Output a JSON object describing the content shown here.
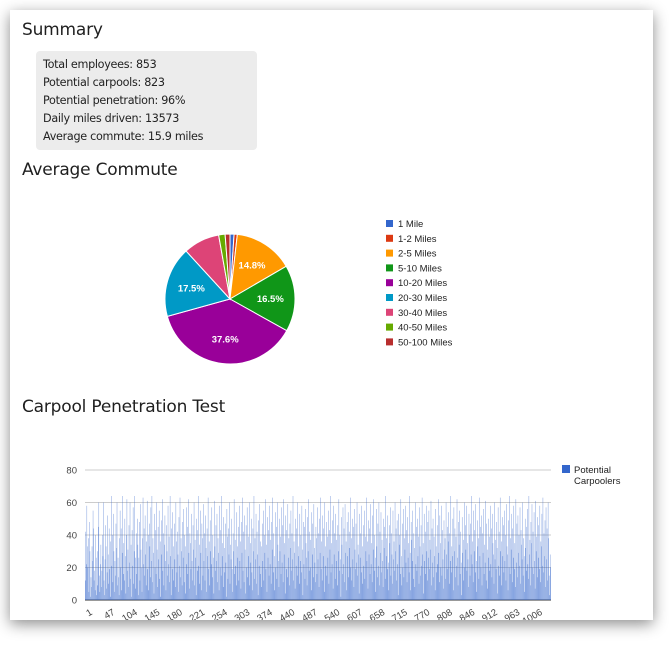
{
  "summary": {
    "title": "Summary",
    "lines": [
      "Total employees: 853",
      "Potential carpools: 823",
      "Potential penetration: 96%",
      "Daily miles driven: 13573",
      "Average commute: 15.9 miles"
    ]
  },
  "avg_commute": {
    "title": "Average Commute"
  },
  "penetration": {
    "title": "Carpool Penetration Test"
  },
  "colors": {
    "1 Mile": "#3366cc",
    "1-2 Miles": "#dc3912",
    "2-5 Miles": "#ff9900",
    "5-10 Miles": "#109618",
    "10-20 Miles": "#990099",
    "20-30 Miles": "#0099c6",
    "30-40 Miles": "#dd4477",
    "40-50 Miles": "#66aa00",
    "50-100 Miles": "#b82e2e"
  },
  "chart_data": [
    {
      "type": "pie",
      "title": "Average Commute",
      "labels": [
        "1 Mile",
        "1-2 Miles",
        "2-5 Miles",
        "5-10 Miles",
        "10-20 Miles",
        "20-30 Miles",
        "30-40 Miles",
        "40-50 Miles",
        "50-100 Miles"
      ],
      "values": [
        1.0,
        0.8,
        14.8,
        16.5,
        37.6,
        17.5,
        9.0,
        1.6,
        1.2
      ],
      "slice_labels": [
        "",
        "",
        "14.8%",
        "16.5%",
        "37.6%",
        "17.5%",
        "",
        "",
        ""
      ],
      "legend": "right"
    },
    {
      "type": "bar",
      "title": "Carpool Penetration Test",
      "series": [
        {
          "name": "Potential Carpoolers"
        }
      ],
      "x_tick_labels": [
        "1",
        "47",
        "104",
        "145",
        "180",
        "221",
        "254",
        "303",
        "374",
        "440",
        "487",
        "540",
        "607",
        "658",
        "715",
        "770",
        "808",
        "846",
        "912",
        "963",
        "1006"
      ],
      "ylim": [
        0,
        80
      ],
      "y_ticks": [
        0,
        20,
        40,
        60,
        80
      ],
      "grid": true,
      "legend": "top-right",
      "values": [
        12,
        42,
        22,
        58,
        33,
        20,
        38,
        5,
        48,
        30,
        2,
        14,
        8,
        33,
        24,
        55,
        44,
        12,
        18,
        6,
        40,
        26,
        3,
        30,
        9,
        45,
        60,
        15,
        5,
        22,
        34,
        8,
        18,
        40,
        27,
        60,
        12,
        3,
        25,
        46,
        33,
        7,
        17,
        52,
        28,
        10,
        44,
        19,
        2,
        36,
        64,
        21,
        40,
        11,
        53,
        30,
        5,
        24,
        15,
        47,
        32,
        60,
        9,
        26,
        14,
        3,
        38,
        55,
        20,
        44,
        6,
        29,
        64,
        16,
        35,
        12,
        50,
        27,
        4,
        40,
        62,
        18,
        31,
        8,
        46,
        23,
        60,
        13,
        34,
        2,
        43,
        21,
        57,
        10,
        30,
        64,
        26,
        7,
        41,
        16,
        50,
        34,
        3,
        26,
        48,
        12,
        59,
        31,
        20,
        5,
        38,
        63,
        22,
        44,
        15,
        52,
        28,
        9,
        36,
        61,
        19,
        40,
        6,
        47,
        33,
        14,
        57,
        24,
        64,
        11,
        38,
        29,
        4,
        53,
        20,
        43,
        16,
        60,
        31,
        8,
        45,
        25,
        55,
        13,
        36,
        2,
        49,
        28,
        62,
        18,
        41,
        9,
        34,
        52,
        24,
        6,
        46,
        30,
        15,
        58,
        22,
        39,
        11,
        64,
        27,
        3,
        44,
        19,
        54,
        33,
        12,
        47,
        25,
        8,
        60,
        36,
        17,
        42,
        28,
        5,
        51,
        21,
        63,
        14,
        38,
        30,
        9,
        48,
        26,
        56,
        11,
        40,
        33,
        4,
        57,
        22,
        45,
        16,
        62,
        29,
        7,
        41,
        35,
        19,
        53,
        24,
        12,
        46,
        31,
        60,
        9,
        37,
        26,
        3,
        50,
        43,
        18,
        64,
        21,
        34,
        10,
        55,
        29,
        6,
        47,
        38,
        15,
        59,
        24,
        41,
        12,
        52,
        32,
        5,
        44,
        27,
        63,
        19,
        36,
        9,
        49,
        30,
        22,
        57,
        14,
        40,
        26,
        4,
        61,
        33,
        18,
        46,
        24,
        53,
        11,
        38,
        29,
        6,
        58,
        20,
        43,
        15,
        64,
        27,
        35,
        8,
        51,
        32,
        17,
        47,
        23,
        2,
        56,
        39,
        13,
        44,
        28,
        60,
        10,
        34,
        25,
        50,
        19,
        5,
        41,
        30,
        62,
        16,
        37,
        21,
        9,
        54,
        33,
        26,
        45,
        12,
        58,
        24,
        36,
        7,
        48,
        29,
        63,
        18,
        42,
        11,
        52,
        31,
        4,
        46,
        20,
        57,
        14,
        39,
        27,
        60,
        9,
        35,
        23,
        50,
        17,
        6,
        44,
        30,
        64,
        13,
        38,
        25,
        53,
        10,
        42,
        28,
        3,
        49,
        21,
        59,
        16,
        36,
        33,
        8,
        47,
        24,
        55,
        12,
        40,
        29,
        62,
        19,
        34,
        5,
        51,
        26,
        43,
        15,
        58,
        22,
        37,
        10,
        48,
        31,
        63,
        17,
        41,
        27,
        6,
        54,
        20,
        45,
        13,
        60,
        34,
        24,
        8,
        50,
        30,
        39,
        16,
        57,
        23,
        46,
        11,
        62,
        28,
        35,
        4,
        52,
        19,
        43,
        14,
        59,
        26,
        38,
        9,
        47,
        32,
        55,
        18,
        41,
        25,
        64,
        12,
        36,
        29,
        7,
        50,
        21,
        44,
        15,
        60,
        33,
        27,
        10,
        53,
        24,
        40,
        17,
        58,
        31,
        3,
        48,
        22,
        45,
        13,
        56,
        35,
        26,
        9,
        51,
        30,
        62,
        18,
        42,
        20,
        37,
        6,
        54,
        28,
        47,
        14,
        59,
        32,
        23,
        11,
        45,
        38,
        16,
        57,
        25,
        41,
        8,
        50,
        29,
        63,
        19,
        36,
        12,
        52,
        27,
        44,
        5,
        60,
        33,
        21,
        48,
        15,
        39,
        26,
        55,
        10,
        43,
        31,
        64,
        17,
        35,
        22,
        49,
        7,
        58,
        28,
        41,
        13,
        53,
        24,
        37,
        9,
        46,
        30,
        62,
        18,
        40,
        25,
        2,
        51,
        34,
        16,
        57,
        22,
        44,
        11,
        59,
        29,
        36,
        6,
        48,
        27,
        54,
        14,
        42,
        32,
        63,
        20,
        38,
        12,
        50,
        25,
        45,
        8,
        56,
        31,
        19,
        47,
        23,
        60,
        15,
        34,
        28,
        4,
        53,
        26,
        41,
        17,
        58,
        33,
        10,
        46,
        21,
        55,
        13,
        39,
        30,
        63,
        24,
        36,
        7,
        49,
        28,
        44,
        16,
        59,
        22,
        35,
        11,
        52,
        31,
        62,
        18,
        40,
        26,
        5,
        56,
        33,
        14,
        47,
        21,
        60,
        9,
        42,
        29,
        54,
        17,
        37,
        24,
        8,
        50,
        32,
        45,
        13,
        64,
        27,
        38,
        19,
        52,
        23,
        6,
        46,
        35,
        57,
        15,
        41,
        28,
        10,
        55,
        25,
        36,
        18,
        60,
        30,
        44,
        12,
        49,
        22,
        3,
        53,
        34,
        40,
        16,
        62,
        27,
        9,
        47,
        20,
        56,
        14,
        38,
        31,
        58,
        23,
        43,
        11,
        51,
        26,
        35,
        17,
        64,
        29,
        6,
        48,
        37,
        24,
        55,
        13,
        41,
        32,
        8,
        60,
        22,
        45,
        18,
        50,
        27,
        39,
        10,
        57,
        33,
        15,
        46,
        21,
        63,
        28,
        35,
        4,
        53,
        24,
        42,
        16,
        58,
        30,
        12,
        48,
        26,
        55,
        19,
        37,
        31,
        61,
        9,
        44,
        23,
        50,
        14,
        39,
        27,
        6,
        56,
        33,
        17,
        46,
        22,
        62,
        29,
        11,
        52,
        35,
        20,
        58,
        15,
        43,
        25,
        7,
        49,
        31,
        38,
        13,
        60,
        28,
        19,
        45,
        36,
        54,
        10,
        41,
        24,
        64,
        17,
        33,
        27,
        50,
        6,
        57,
        30,
        44,
        14,
        39,
        21,
        62,
        26,
        9,
        48,
        34,
        55,
        16,
        42,
        23,
        3,
        51,
        29,
        37,
        12,
        60,
        20,
        46,
        31,
        58,
        18,
        35,
        25,
        8,
        53,
        40,
        15,
        47,
        28,
        64,
        22,
        36,
        11,
        55,
        30,
        43,
        17,
        59,
        24,
        5,
        49,
        33,
        38,
        13,
        63,
        27,
        45,
        20,
        52,
        9,
        41,
        29,
        56,
        16,
        34,
        23,
        61,
        12,
        47,
        31,
        7,
        50,
        26,
        39,
        18,
        58,
        22,
        44,
        14,
        53,
        35,
        28,
        10,
        60,
        25,
        37,
        19,
        48,
        32,
        4,
        57,
        21,
        42,
        15,
        63,
        30,
        36,
        9,
        51,
        27,
        46,
        17,
        55,
        24,
        40,
        12,
        59,
        33,
        28,
        6,
        49,
        20,
        64,
        16,
        38,
        31,
        53,
        11,
        44,
        26,
        58,
        19,
        35,
        8,
        62,
        23,
        47,
        14,
        52,
        29,
        40,
        21,
        57,
        10,
        43,
        34,
        25,
        60,
        15,
        38,
        27,
        5,
        50,
        32,
        45,
        18,
        56,
        22,
        13,
        64,
        28,
        37,
        9,
        48,
        35,
        59,
        20,
        42,
        16,
        54,
        24,
        7,
        61,
        30,
        39,
        14,
        51,
        26,
        46,
        19,
        58,
        11,
        36,
        33,
        53,
        21,
        63,
        17,
        41,
        27,
        49,
        8,
        57,
        25,
        44,
        12,
        60,
        38,
        15,
        3,
        28,
        20
      ]
    }
  ]
}
